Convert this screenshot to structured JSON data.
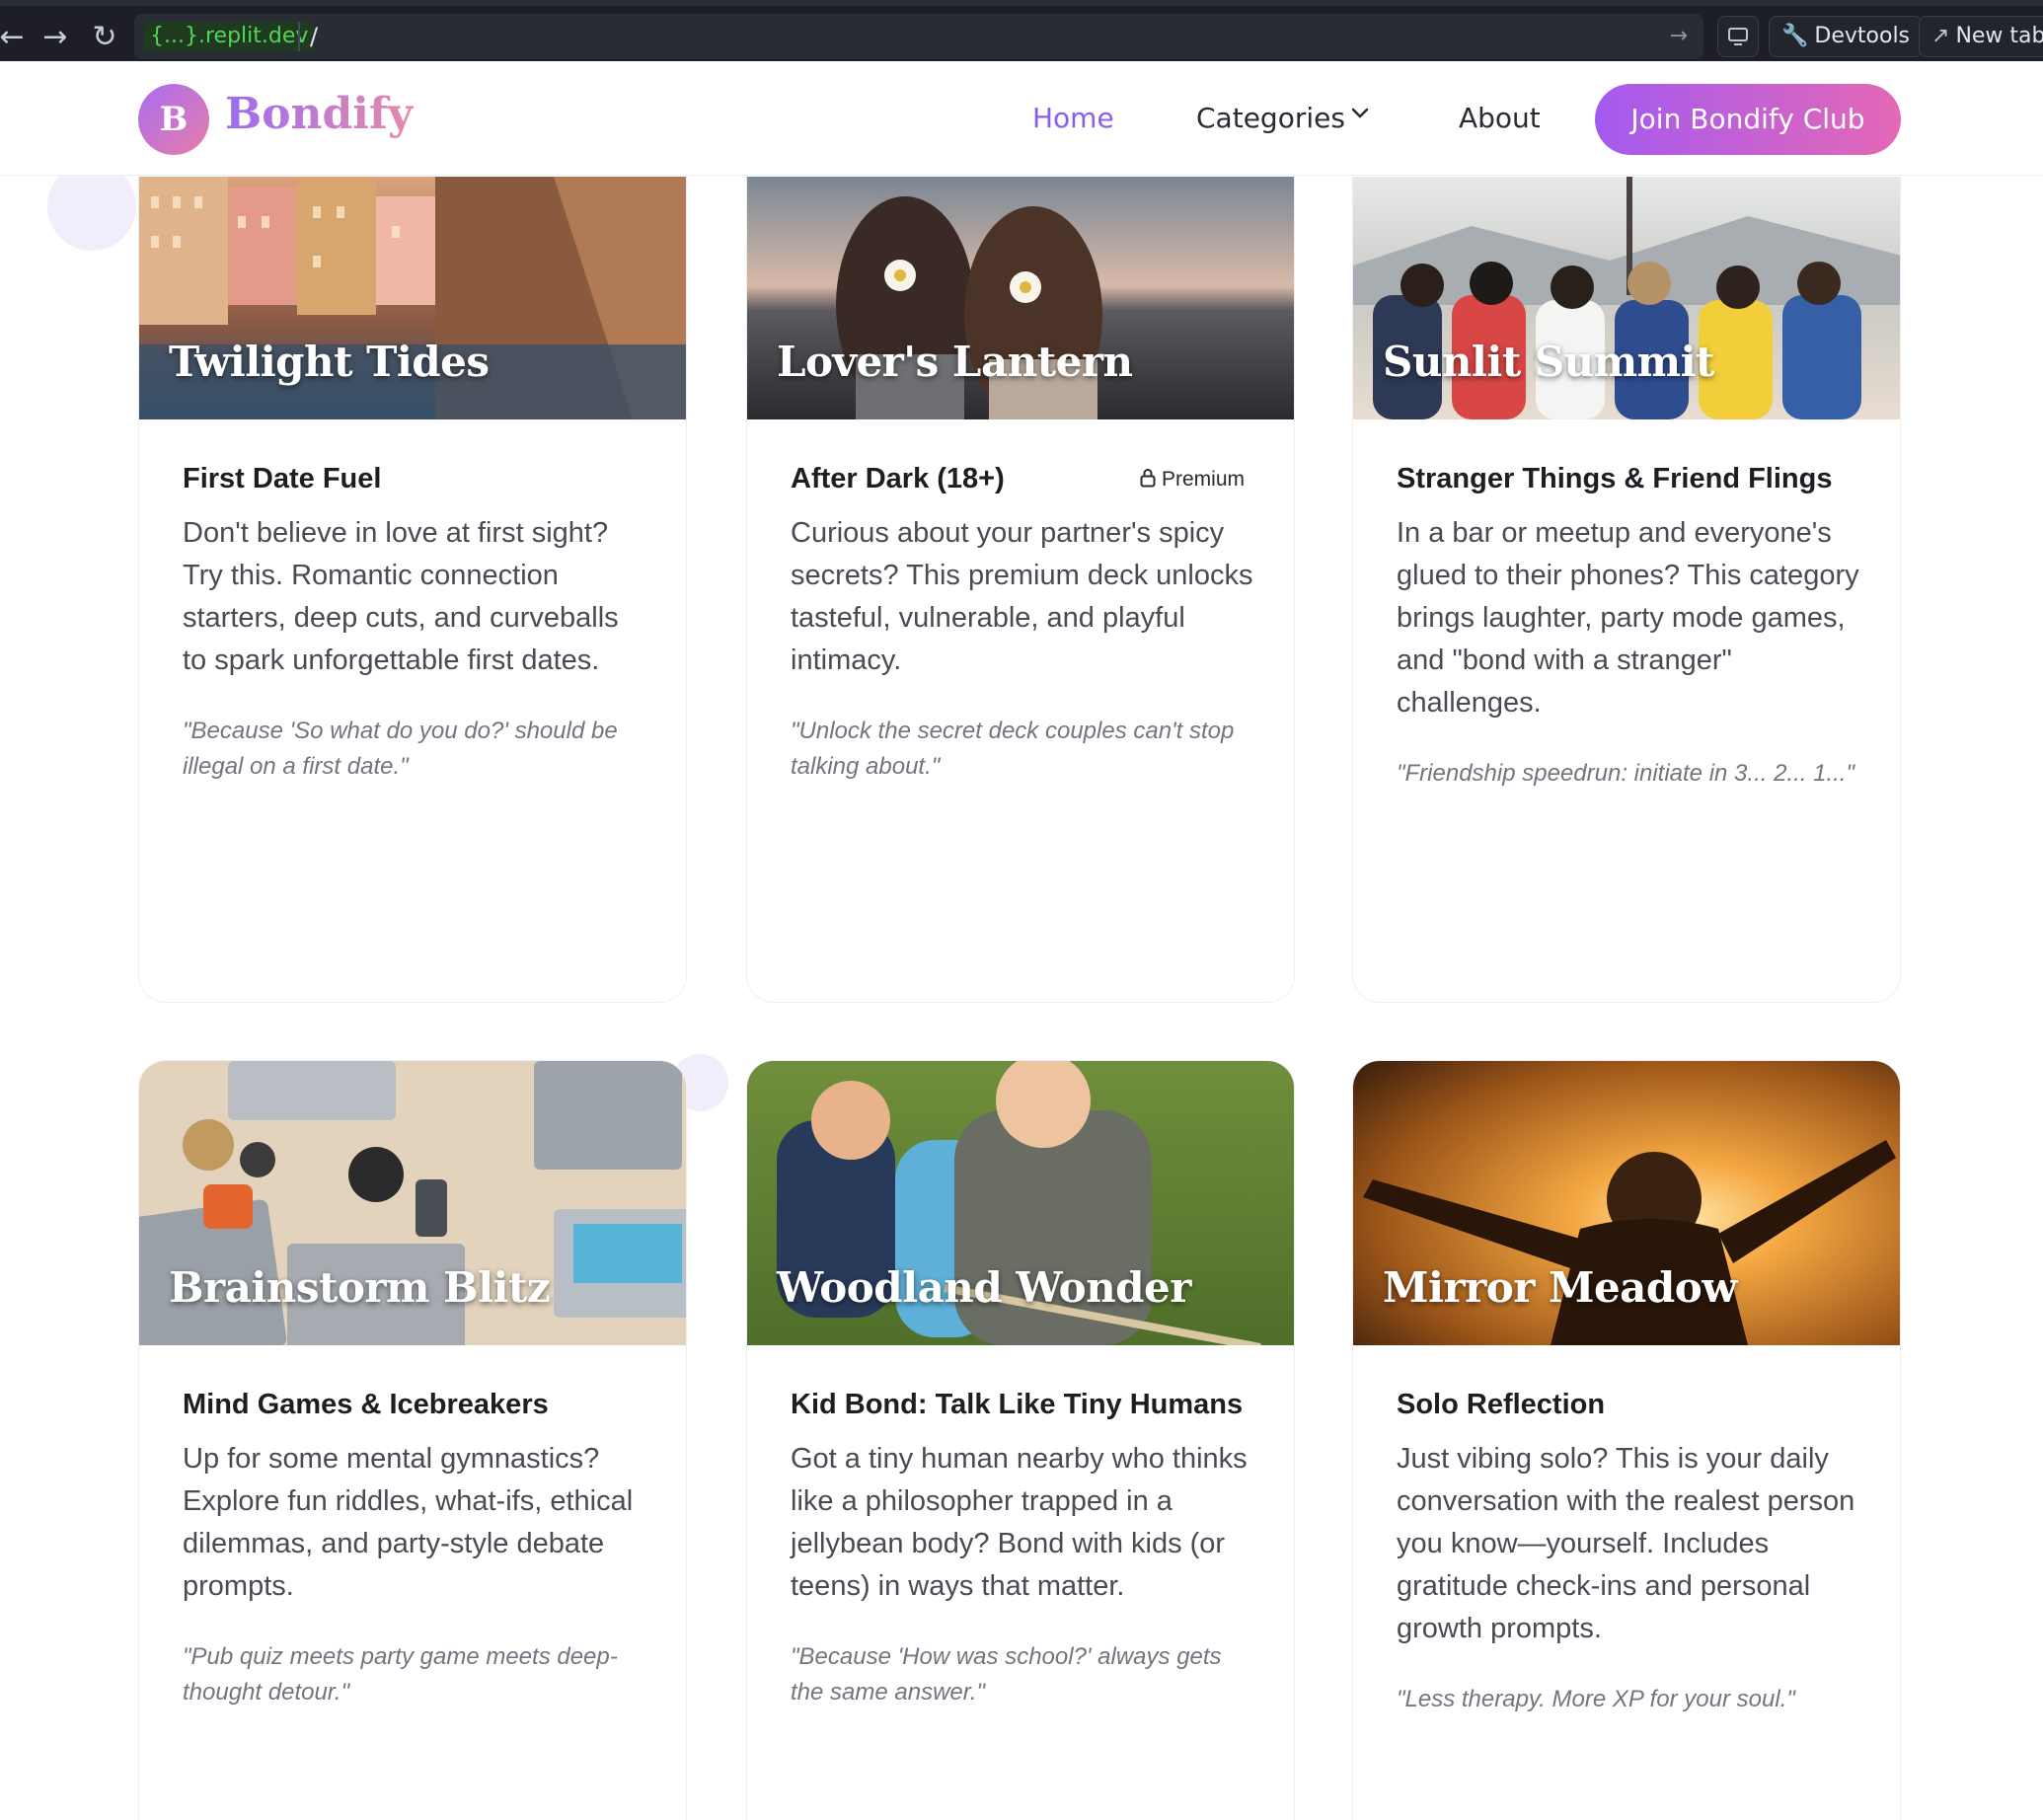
{
  "browser": {
    "back_glyph": "←",
    "forward_glyph": "→",
    "reload_glyph": "↻",
    "url_host": "{...}.replit.dev",
    "url_path": "/",
    "go_glyph": "→",
    "devtools_label": "Devtools",
    "new_tab_label": "New tab"
  },
  "site": {
    "logo_letter": "B",
    "brand_name": "Bondify",
    "nav": {
      "home": "Home",
      "categories": "Categories",
      "about": "About"
    },
    "cta_label": "Join Bondify Club",
    "colors": {
      "accent": "#8a5cf0",
      "cta_start": "#a45af0",
      "cta_end": "#e468b5"
    }
  },
  "cards": [
    {
      "image_title": "Twilight Tides",
      "title": "First Date Fuel",
      "description": "Don't believe in love at first sight? Try this. Romantic connection starters, deep cuts, and curveballs to spark unforgettable first dates.",
      "quote": "\"Because 'So what do you do?' should be illegal on a first date.\""
    },
    {
      "image_title": "Lover's Lantern",
      "title": "After Dark (18+)",
      "badge": "Premium",
      "description": "Curious about your partner's spicy secrets? This premium deck unlocks tasteful, vulnerable, and playful intimacy.",
      "quote": "\"Unlock the secret deck couples can't stop talking about.\""
    },
    {
      "image_title": "Sunlit Summit",
      "title": "Stranger Things & Friend Flings",
      "description": "In a bar or meetup and everyone's glued to their phones? This category brings laughter, party mode games, and \"bond with a stranger\" challenges.",
      "quote": "\"Friendship speedrun: initiate in 3... 2... 1...\""
    },
    {
      "image_title": "Brainstorm Blitz",
      "title": "Mind Games & Icebreakers",
      "description": "Up for some mental gymnastics? Explore fun riddles, what-ifs, ethical dilemmas, and party-style debate prompts.",
      "quote": "\"Pub quiz meets party game meets deep-thought detour.\""
    },
    {
      "image_title": "Woodland Wonder",
      "title": "Kid Bond: Talk Like Tiny Humans",
      "description": "Got a tiny human nearby who thinks like a philosopher trapped in a jellybean body? Bond with kids (or teens) in ways that matter.",
      "quote": "\"Because 'How was school?' always gets the same answer.\""
    },
    {
      "image_title": "Mirror Meadow",
      "title": "Solo Reflection",
      "description": "Just vibing solo? This is your daily conversation with the realest person you know—yourself. Includes gratitude check-ins and personal growth prompts.",
      "quote": "\"Less therapy. More XP for your soul.\""
    }
  ]
}
